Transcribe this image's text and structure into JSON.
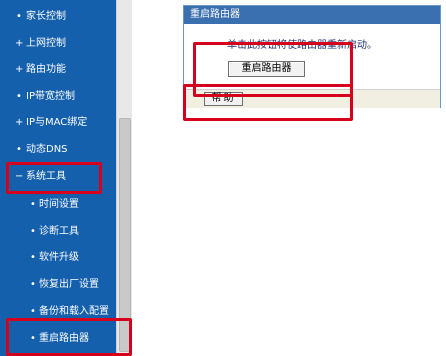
{
  "sidebar": {
    "items": [
      {
        "bullet": "•",
        "label": "家长控制"
      },
      {
        "bullet": "+",
        "label": "上网控制"
      },
      {
        "bullet": "+",
        "label": "路由功能"
      },
      {
        "bullet": "•",
        "label": "IP带宽控制"
      },
      {
        "bullet": "+",
        "label": "IP与MAC绑定"
      },
      {
        "bullet": "•",
        "label": "动态DNS"
      },
      {
        "bullet": "−",
        "label": "系统工具"
      },
      {
        "bullet": "•",
        "label": "时间设置"
      },
      {
        "bullet": "•",
        "label": "诊断工具"
      },
      {
        "bullet": "•",
        "label": "软件升级"
      },
      {
        "bullet": "•",
        "label": "恢复出厂设置"
      },
      {
        "bullet": "•",
        "label": "备份和载入配置"
      },
      {
        "bullet": "•",
        "label": "重启路由器"
      }
    ]
  },
  "panel": {
    "title": "重启路由器",
    "instruction": "单击此按钮将使路由器重新启动。",
    "reboot_button": "重启路由器",
    "help_button": "帮助"
  },
  "colors": {
    "sidebar_bg": "#1460ad",
    "header_bg": "#3a6fb0",
    "highlight": "#d6001c"
  }
}
